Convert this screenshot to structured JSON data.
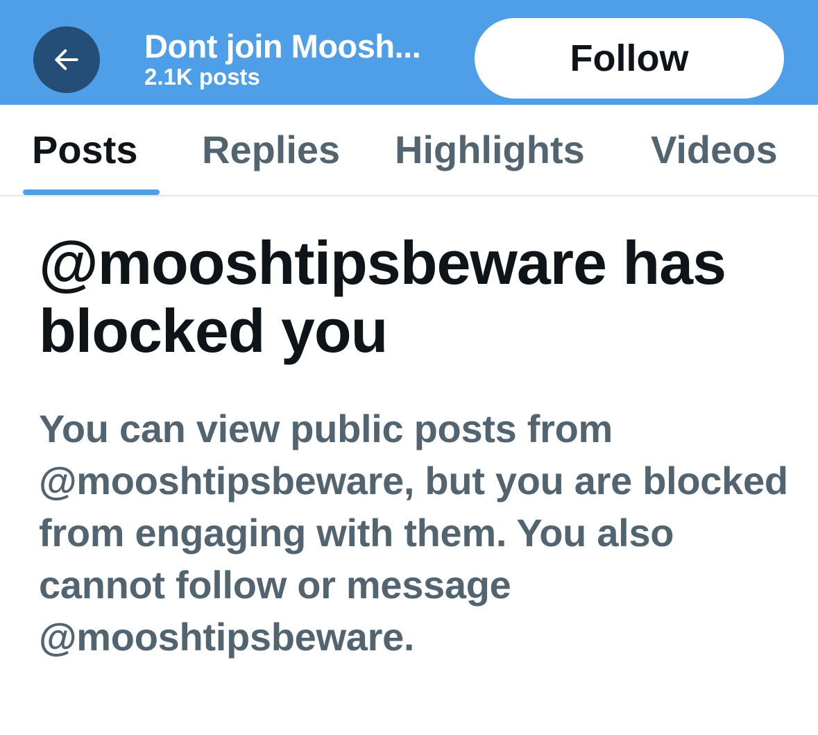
{
  "header": {
    "back_icon": "arrow-left-icon",
    "title": "Dont join Moosh...",
    "post_count": "2.1K posts",
    "follow_label": "Follow",
    "background_color": "#4f9fe8"
  },
  "tabs": [
    {
      "label": "Posts",
      "active": true
    },
    {
      "label": "Replies",
      "active": false
    },
    {
      "label": "Highlights",
      "active": false
    },
    {
      "label": "Videos",
      "active": false
    }
  ],
  "blocked_notice": {
    "title": "@mooshtipsbeware has blocked you",
    "body": "You can view public posts from @mooshtipsbeware, but you are blocked from engaging with them. You also cannot follow or message @mooshtipsbeware."
  }
}
